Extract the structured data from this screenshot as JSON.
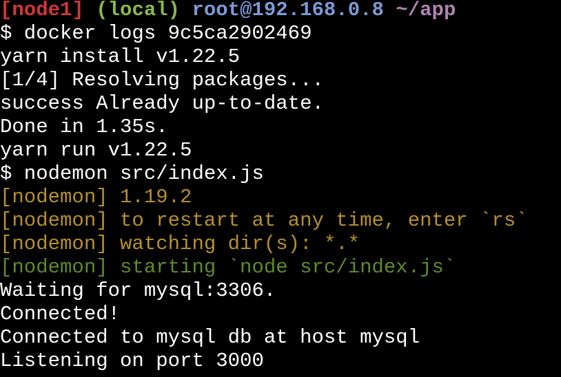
{
  "prompt": {
    "node": "[node1]",
    "local": "(local)",
    "user_host": "root@192.168.0.8",
    "cwd": "~/app"
  },
  "colors": {
    "background": "#000000",
    "text": "#ffffff",
    "node": "#d2353a",
    "local": "#8ab84a",
    "host": "#7d9ad6",
    "path": "#b083b3",
    "nodemon_yellow": "#b7902b",
    "nodemon_green": "#5f8a2e"
  },
  "lines": {
    "cmd_docker": "$ docker logs 9c5ca2902469",
    "yarn_install": "yarn install v1.22.5",
    "resolving": "[1/4] Resolving packages...",
    "success": "success Already up-to-date.",
    "done": "Done in 1.35s.",
    "yarn_run": "yarn run v1.22.5",
    "cmd_nodemon": "$ nodemon src/index.js",
    "nodemon_version": "[nodemon] 1.19.2",
    "nodemon_restart": "[nodemon] to restart at any time, enter `rs`",
    "nodemon_watch": "[nodemon] watching dir(s): *.*",
    "nodemon_start": "[nodemon] starting `node src/index.js`",
    "waiting": "Waiting for mysql:3306.",
    "connected": "Connected!",
    "connected_db": "Connected to mysql db at host mysql",
    "listening": "Listening on port 3000"
  }
}
